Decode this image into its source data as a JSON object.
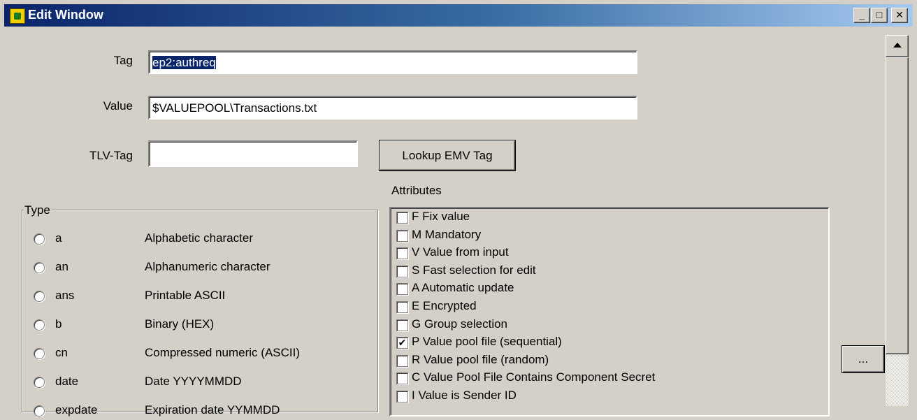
{
  "window": {
    "title": "Edit Window",
    "minimize": "_",
    "maximize": "□",
    "close": "✕"
  },
  "fields": {
    "tag_label": "Tag",
    "tag_value": "ep2:authreq",
    "value_label": "Value",
    "value_value": "$VALUEPOOL\\Transactions.txt",
    "tlv_label": "TLV-Tag",
    "tlv_value": ""
  },
  "buttons": {
    "lookup": "Lookup EMV Tag",
    "ellipsis": "..."
  },
  "type_group": {
    "title": "Type",
    "options": [
      {
        "code": "a",
        "desc": "Alphabetic character",
        "selected": false
      },
      {
        "code": "an",
        "desc": "Alphanumeric character",
        "selected": false
      },
      {
        "code": "ans",
        "desc": "Printable ASCII",
        "selected": false
      },
      {
        "code": "b",
        "desc": "Binary (HEX)",
        "selected": false
      },
      {
        "code": "cn",
        "desc": "Compressed numeric (ASCII)",
        "selected": false
      },
      {
        "code": "date",
        "desc": "Date YYYYMMDD",
        "selected": false
      },
      {
        "code": "expdate",
        "desc": "Expiration date YYMMDD",
        "selected": false
      }
    ]
  },
  "attributes": {
    "title": "Attributes",
    "items": [
      {
        "label": "F  Fix value",
        "checked": false
      },
      {
        "label": "M Mandatory",
        "checked": false
      },
      {
        "label": "V  Value from input",
        "checked": false
      },
      {
        "label": "S Fast selection for edit",
        "checked": false
      },
      {
        "label": "A Automatic update",
        "checked": false
      },
      {
        "label": "E Encrypted",
        "checked": false
      },
      {
        "label": "G Group selection",
        "checked": false
      },
      {
        "label": "P Value pool file (sequential)",
        "checked": true
      },
      {
        "label": "R Value pool file (random)",
        "checked": false
      },
      {
        "label": "C Value Pool File Contains Component Secret",
        "checked": false
      },
      {
        "label": "I Value is Sender ID",
        "checked": false
      }
    ]
  },
  "check_mark": "✔"
}
